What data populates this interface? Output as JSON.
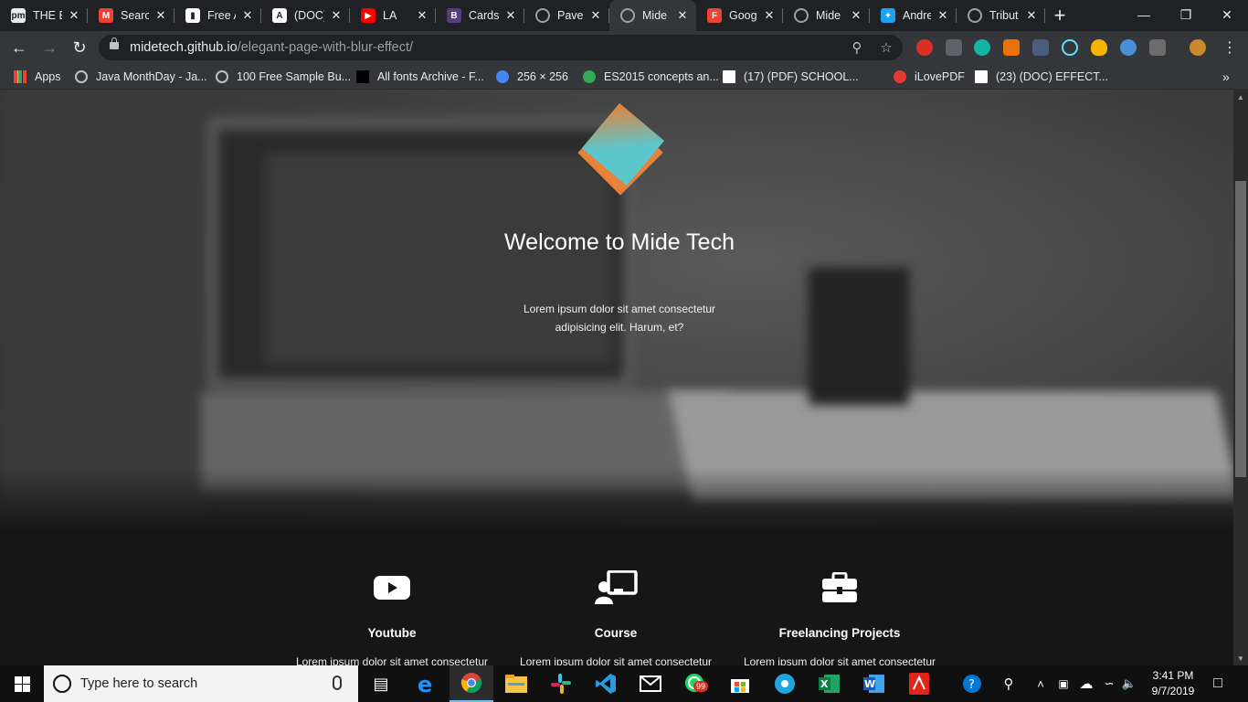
{
  "browser": {
    "tabs": [
      {
        "title": "THE E",
        "favicon": "pm-icon",
        "color": "#e8eaed"
      },
      {
        "title": "Searc",
        "favicon": "gmail-icon",
        "color": "#ea4335"
      },
      {
        "title": "Free A",
        "favicon": "bookmark-book-icon",
        "color": "#ffffff"
      },
      {
        "title": "(DOC)",
        "favicon": "academia-icon",
        "color": "#ffffff"
      },
      {
        "title": "LA",
        "favicon": "youtube-icon",
        "color": "#ff0000"
      },
      {
        "title": "Cards",
        "favicon": "bootstrap-icon",
        "color": "#563d7c"
      },
      {
        "title": "Pavel",
        "favicon": "globe-icon",
        "color": "#9aa0a6"
      },
      {
        "title": "Mide",
        "favicon": "globe-icon",
        "color": "#9aa0a6"
      },
      {
        "title": "Goog",
        "favicon": "f-red-icon",
        "color": "#ea4335"
      },
      {
        "title": "Mide",
        "favicon": "globe-icon",
        "color": "#9aa0a6"
      },
      {
        "title": "Andre",
        "favicon": "twitter-icon",
        "color": "#1da1f2"
      },
      {
        "title": "Tribut",
        "favicon": "globe-icon",
        "color": "#9aa0a6"
      }
    ],
    "active_tab_index": 7,
    "url_host": "midetech.github.io",
    "url_path": "/elegant-page-with-blur-effect/",
    "bookmarks": [
      {
        "label": "Apps",
        "icon": "apps-grid-icon"
      },
      {
        "label": "Java MonthDay - Ja...",
        "icon": "globe-icon"
      },
      {
        "label": "100 Free Sample Bu...",
        "icon": "globe-icon"
      },
      {
        "label": "All fonts Archive - F...",
        "icon": "f-bold-icon"
      },
      {
        "label": "256 × 256",
        "icon": "google-icon"
      },
      {
        "label": "ES2015 concepts an...",
        "icon": "es-icon"
      },
      {
        "label": "(17) (PDF) SCHOOL...",
        "icon": "academia-icon"
      },
      {
        "label": "iLovePDF",
        "icon": "heart-icon"
      },
      {
        "label": "(23) (DOC) EFFECT...",
        "icon": "academia-icon"
      }
    ]
  },
  "page": {
    "hero_title": "Welcome to Mide Tech",
    "hero_text": "Lorem ipsum dolor sit amet consectetur adipisicing elit. Harum, et?",
    "features": [
      {
        "icon": "youtube-play-icon",
        "title": "Youtube",
        "text": "Lorem ipsum dolor sit amet consectetur"
      },
      {
        "icon": "teacher-board-icon",
        "title": "Course",
        "text": "Lorem ipsum dolor sit amet consectetur"
      },
      {
        "icon": "briefcase-icon",
        "title": "Freelancing Projects",
        "text": "Lorem ipsum dolor sit amet consectetur"
      }
    ],
    "colors": {
      "logo_teal": "#5bc6cc",
      "logo_orange": "#e8813a"
    }
  },
  "taskbar": {
    "search_placeholder": "Type here to search",
    "whatsapp_badge": "99",
    "time": "3:41 PM",
    "date": "9/7/2019"
  }
}
